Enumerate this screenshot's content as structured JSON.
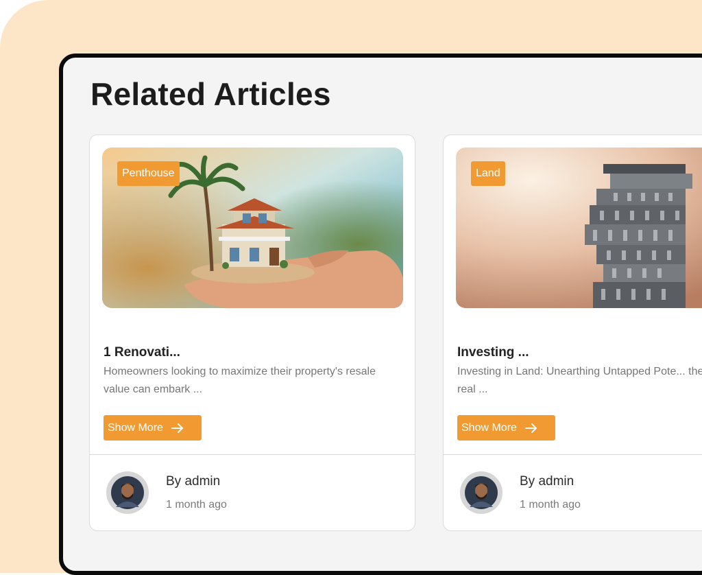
{
  "section": {
    "title": "Related Articles"
  },
  "articles": [
    {
      "tag": "Penthouse",
      "title": "1 Renovati...",
      "excerpt": "Homeowners looking to maximize their property's resale value can embark ...",
      "button_label": "Show More",
      "button_icon": "arrow-right-icon",
      "author": "By admin",
      "date": "1 month ago"
    },
    {
      "tag": "Land",
      "title": "Investing ...",
      "excerpt": "Investing in Land: Unearthing Untapped Pote... the bustling real ...",
      "button_label": "Show More",
      "button_icon": "arrow-right-icon",
      "author": "By admin",
      "date": "1 month ago"
    }
  ],
  "colors": {
    "accent": "#f29a32",
    "background_peach": "#fde6c8",
    "panel": "#f4f4f4",
    "frame_border": "#0b0b0b"
  }
}
